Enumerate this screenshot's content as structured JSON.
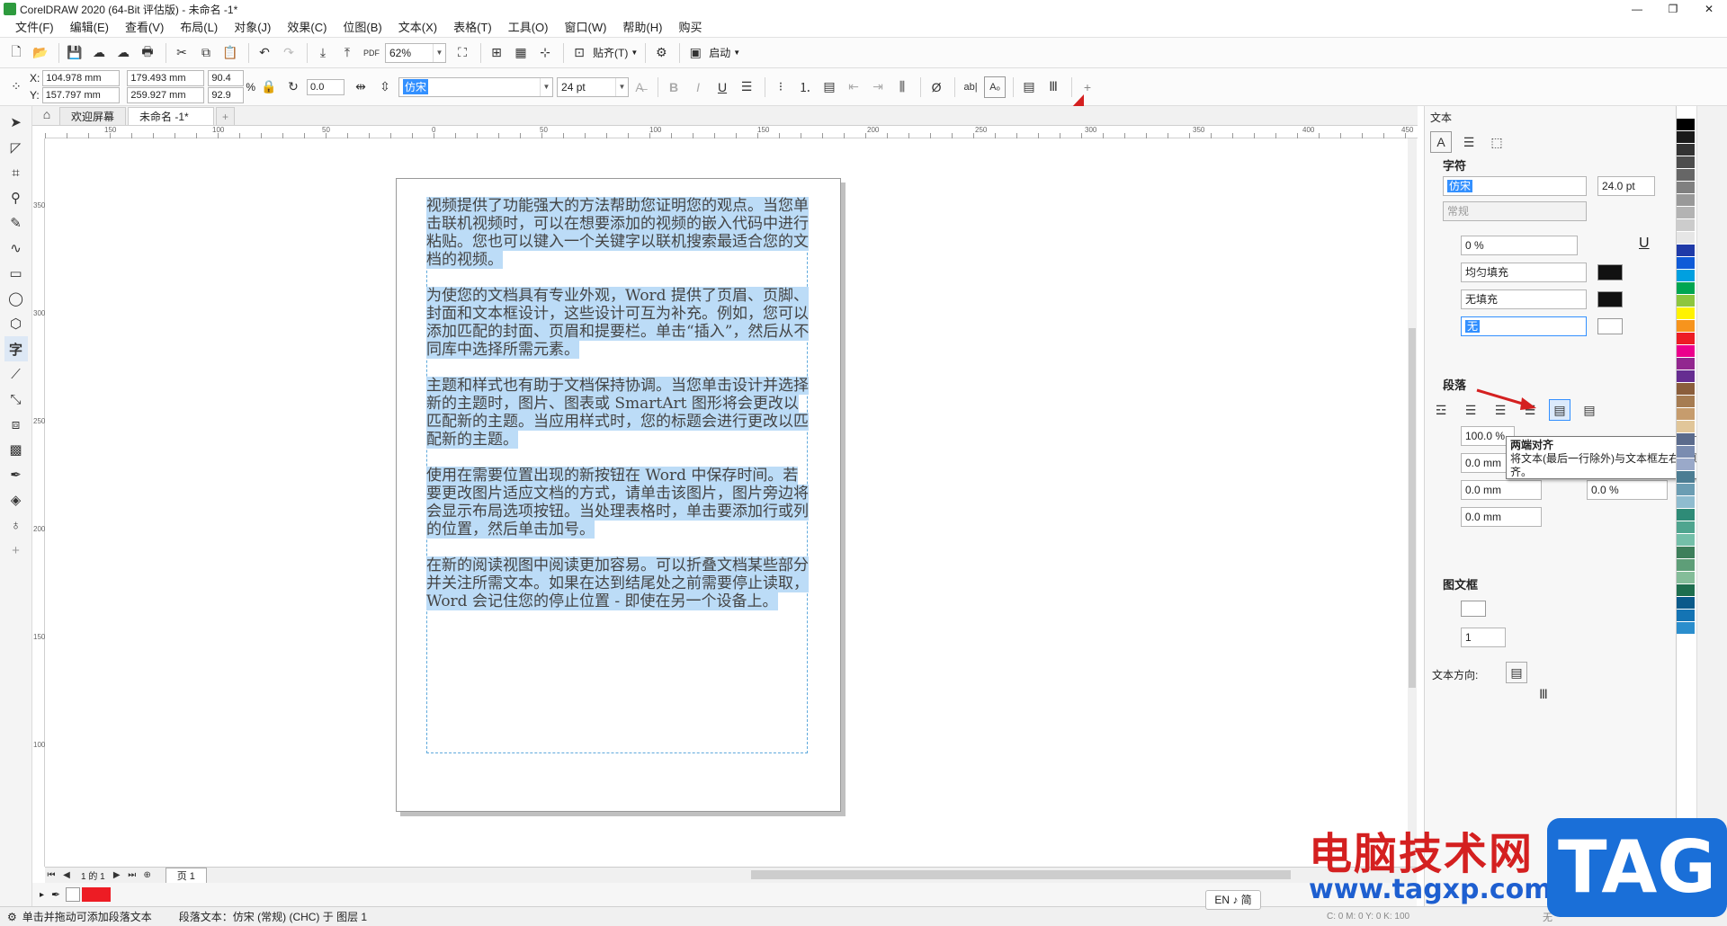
{
  "window": {
    "title": "CorelDRAW 2020 (64-Bit 评估版) - 未命名 -1*",
    "minimize": "—",
    "restore": "❐",
    "close": "✕"
  },
  "menu": [
    "文件(F)",
    "编辑(E)",
    "查看(V)",
    "布局(L)",
    "对象(J)",
    "效果(C)",
    "位图(B)",
    "文本(X)",
    "表格(T)",
    "工具(O)",
    "窗口(W)",
    "帮助(H)",
    "购买"
  ],
  "std_toolbar": {
    "zoom": "62%",
    "snap_label": "贴齐(T)",
    "launch_label": "启动"
  },
  "prop_bar": {
    "x_label": "X:",
    "x": "104.978 mm",
    "y_label": "Y:",
    "y": "157.797 mm",
    "w": "179.493 mm",
    "h": "259.927 mm",
    "sx": "90.4",
    "sy": "92.9",
    "pct": "%",
    "angle": "0.0",
    "font": "仿宋",
    "size": "24 pt"
  },
  "doc_tabs": {
    "welcome": "欢迎屏幕",
    "doc": "未命名 -1*",
    "add": "+"
  },
  "ruler_h": [
    "150",
    "100",
    "50",
    "0",
    "50",
    "100",
    "150",
    "200",
    "250",
    "300",
    "350",
    "400",
    "450"
  ],
  "ruler_v": [
    "350",
    "300",
    "250",
    "200",
    "150",
    "100"
  ],
  "text_paragraphs": [
    "视频提供了功能强大的方法帮助您证明您的观点。当您单击联机视频时，可以在想要添加的视频的嵌入代码中进行粘贴。您也可以键入一个关键字以联机搜索最适合您的文档的视频。",
    "为使您的文档具有专业外观，Word 提供了页眉、页脚、封面和文本框设计，这些设计可互为补充。例如，您可以添加匹配的封面、页眉和提要栏。单击“插入”，然后从不同库中选择所需元素。",
    "主题和样式也有助于文档保持协调。当您单击设计并选择新的主题时，图片、图表或 SmartArt 图形将会更改以匹配新的主题。当应用样式时，您的标题会进行更改以匹配新的主题。",
    "使用在需要位置出现的新按钮在 Word 中保存时间。若要更改图片适应文档的方式，请单击该图片，图片旁边将会显示布局选项按钮。当处理表格时，单击要添加行或列的位置，然后单击加号。",
    "在新的阅读视图中阅读更加容易。可以折叠文档某些部分并关注所需文本。如果在达到结尾处之前需要停止读取，Word 会记住您的停止位置 - 即使在另一个设备上。"
  ],
  "page_nav": {
    "page_info": "1 的 1",
    "page_tab": "页 1"
  },
  "panel": {
    "title": "文本",
    "char_header": "字符",
    "font": "仿宋",
    "font_size": "24.0 pt",
    "style": "常规",
    "kerning": "0 %",
    "fill": "均匀填充",
    "bg_fill": "无填充",
    "outline": "无",
    "para_header": "段落",
    "indent_pct": "100.0 %",
    "before": "0.0 mm",
    "after": "0.0 mm",
    "first": "0.0 mm",
    "space_pct": "0.0 %",
    "frame_header": "图文框",
    "columns": "1",
    "direction_label": "文本方向:"
  },
  "tooltip": {
    "title": "两端对齐",
    "body": "将文本(最后一行除外)与文本框左右两侧对齐。"
  },
  "status": {
    "hint": "单击并拖动可添加段落文本",
    "info": "段落文本：仿宋 (常规) (CHC) 于 图层 1",
    "color_info": "C: 0 M: 0 Y: 0 K: 100",
    "fill_none": "无"
  },
  "ime": "EN ♪ 简",
  "watermark": {
    "cn": "电脑技术网",
    "url": "www.tagxp.com",
    "tag": "TAG"
  },
  "colors": {
    "accent": "#3390ff",
    "selection": "#bcdcf7",
    "arrow": "#d42020"
  },
  "palette": [
    "#ffffff",
    "#000000",
    "#1a1a1a",
    "#333333",
    "#4d4d4d",
    "#666666",
    "#808080",
    "#999999",
    "#b3b3b3",
    "#cccccc",
    "#e6e6e6",
    "#1f3aa8",
    "#0f5bd8",
    "#00a0e0",
    "#00a651",
    "#8dc63f",
    "#fff200",
    "#f7941d",
    "#ed1c24",
    "#ec008c",
    "#92278f",
    "#662d91",
    "#8b5e3c",
    "#a67c52",
    "#c69c6d",
    "#e1c699",
    "#5b6b8c",
    "#7a8cb0",
    "#9aa9c9",
    "#4c7d93",
    "#6b9db3",
    "#8fbccf",
    "#2e8b77",
    "#4fa58f",
    "#74bfa9",
    "#3d7f5b",
    "#5e9e78",
    "#84bd99",
    "#1e6e4e",
    "#0a5a8a",
    "#1474b4",
    "#2b8ecd"
  ]
}
